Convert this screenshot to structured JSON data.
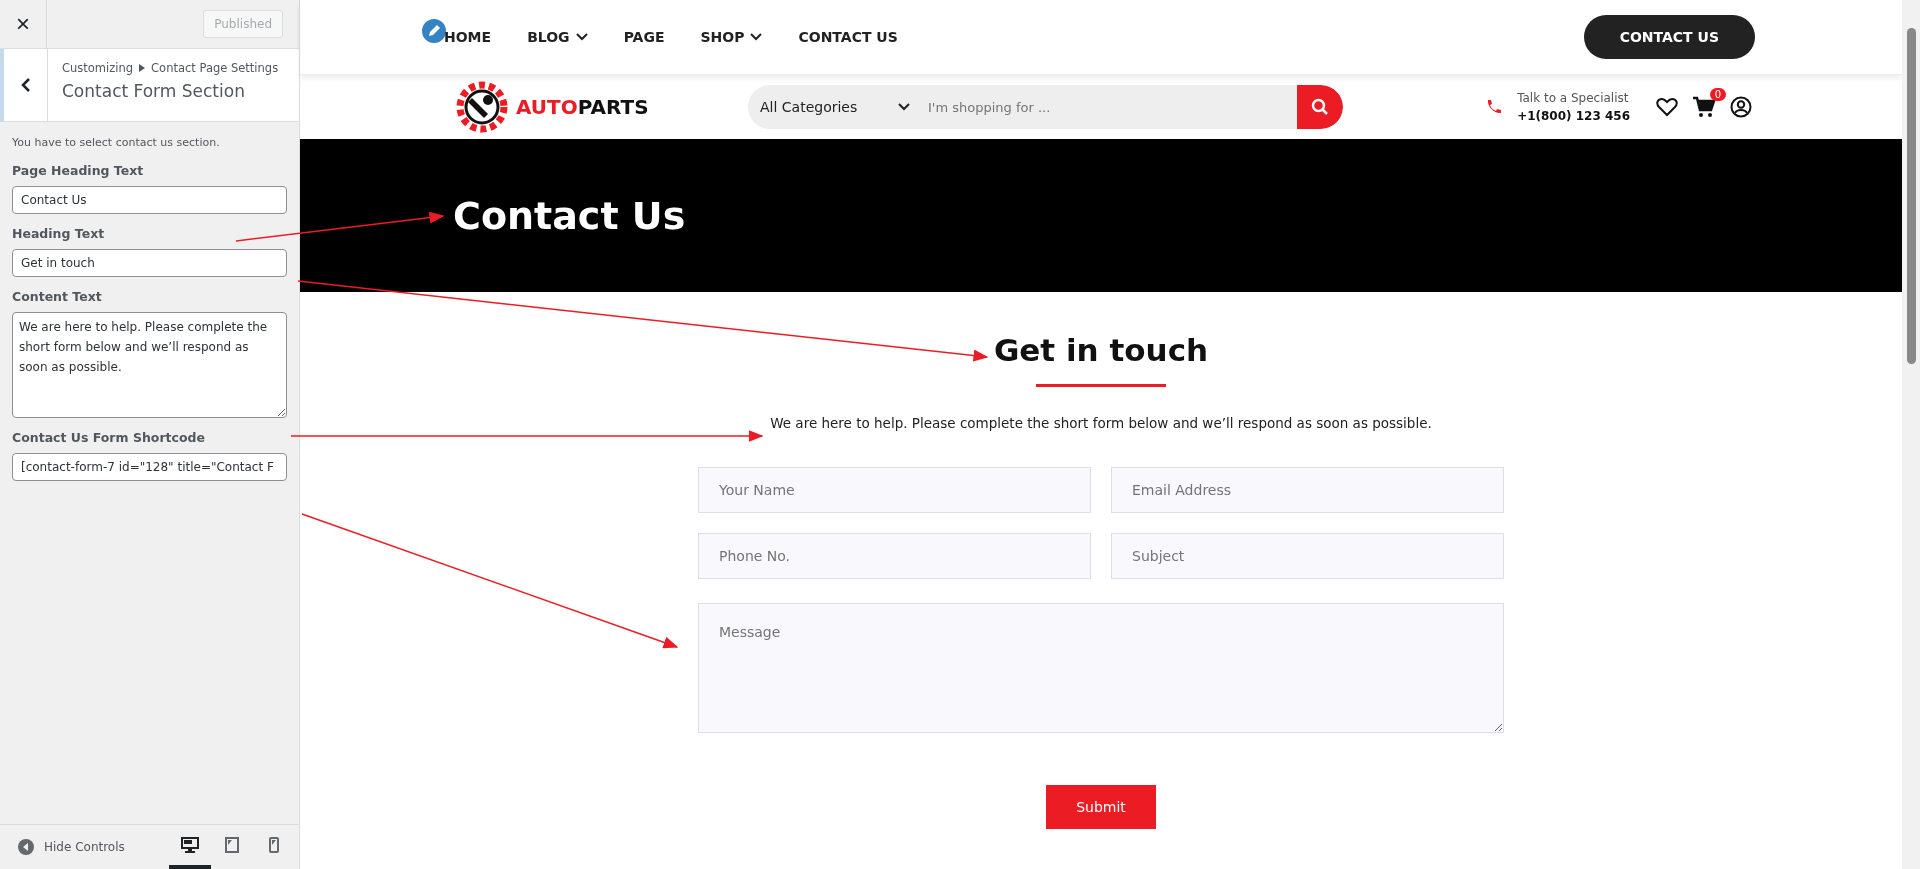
{
  "customizer": {
    "close": "×",
    "publish_button": "Published",
    "breadcrumb": [
      "Customizing",
      "Contact Page Settings"
    ],
    "section_title": "Contact Form Section",
    "description": "You have to select contact us section.",
    "fields": [
      {
        "kind": "text",
        "label": "Page Heading Text",
        "value": "Contact Us"
      },
      {
        "kind": "text",
        "label": "Heading Text",
        "value": "Get in touch"
      },
      {
        "kind": "textarea",
        "label": "Content Text",
        "value": "We are here to help. Please complete the short form below and we’ll respond as soon as possible."
      },
      {
        "kind": "text",
        "label": "Contact Us Form Shortcode",
        "value": "[contact-form-7 id=\"128\" title=\"Contact F"
      }
    ],
    "hide_controls": "Hide Controls",
    "devices": [
      {
        "kind": "desktop",
        "selected": true
      },
      {
        "kind": "tablet",
        "selected": false
      },
      {
        "kind": "mobile",
        "selected": false
      }
    ]
  },
  "site": {
    "nav": [
      {
        "label": "HOME",
        "dropdown": false
      },
      {
        "label": "BLOG",
        "dropdown": true
      },
      {
        "label": "PAGE",
        "dropdown": false
      },
      {
        "label": "SHOP",
        "dropdown": true
      },
      {
        "label": "CONTACT US",
        "dropdown": false
      }
    ],
    "header_button": "CONTACT US",
    "logo": {
      "part_1": "AUTO",
      "part_2": "PARTS"
    },
    "search": {
      "category": "All Categories",
      "placeholder": "I'm shopping for ..."
    },
    "contact": {
      "caption": "Talk to a Specialist",
      "phone": "+1(800) 123 456"
    },
    "cart_count": "0",
    "banner_title": "Contact Us",
    "heading": "Get in touch",
    "content": "We are here to help. Please complete the short form below and we’ll respond as soon as possible.",
    "form_fields": [
      {
        "kind": "input",
        "placeholder": "Your Name"
      },
      {
        "kind": "input",
        "placeholder": "Email Address"
      },
      {
        "kind": "input",
        "placeholder": "Phone No."
      },
      {
        "kind": "input",
        "placeholder": "Subject"
      },
      {
        "kind": "textarea",
        "placeholder": "Message"
      }
    ],
    "submit": "Submit"
  }
}
